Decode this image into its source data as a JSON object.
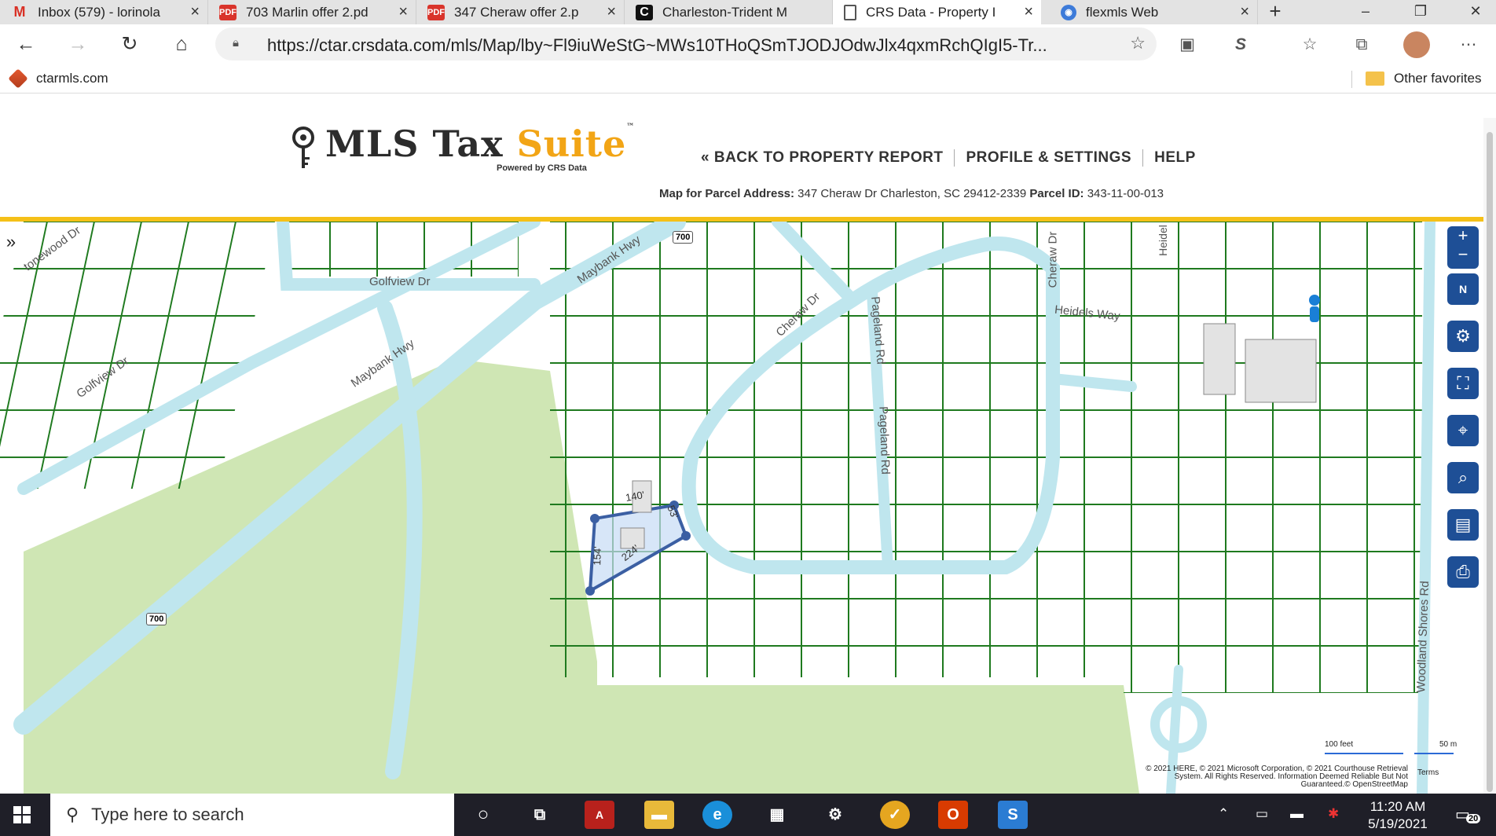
{
  "browser": {
    "tabs": [
      {
        "label": "Inbox (579) - lorinola",
        "icon": "gmail-icon"
      },
      {
        "label": "703 Marlin offer 2.pd",
        "icon": "pdf-icon"
      },
      {
        "label": "347 Cheraw offer 2.p",
        "icon": "pdf-icon"
      },
      {
        "label": "Charleston-Trident M",
        "icon": "c-icon"
      },
      {
        "label": "CRS Data - Property I",
        "icon": "page-icon"
      },
      {
        "label": "flexmls Web",
        "icon": "flexmls-icon"
      }
    ],
    "url": "https://ctar.crsdata.com/mls/Map/lby~Fl9iuWeStG~MWs10THoQSmTJODJOdwJlx4qxmRchQIgI5-Tr...",
    "favorites": {
      "site": "ctarmls.com",
      "other": "Other favorites"
    }
  },
  "header": {
    "logo_main": "MLS Tax ",
    "logo_accent": "Suite",
    "logo_tm": "™",
    "powered_by": "Powered by CRS Data",
    "nav": [
      "« BACK TO PROPERTY REPORT",
      "PROFILE & SETTINGS",
      "HELP"
    ],
    "map_for_label": "Map for Parcel Address:",
    "parcel_address": "347 Cheraw Dr Charleston, SC 29412-2339",
    "parcel_id_label": "Parcel ID:",
    "parcel_id": "343-11-00-013"
  },
  "map": {
    "side_toggle": "»",
    "street_labels": {
      "golfview_top": "Golfview Dr",
      "golfview_bottom": "Golfview Dr",
      "maybank_top": "Maybank Hwy",
      "maybank_bottom": "Maybank Hwy",
      "stonewood": "tonewood Dr",
      "cheraw_ne": "Cheraw Dr",
      "cheraw_curve": "Cheraw Dr",
      "pageland_top": "Pageland Rd",
      "pageland_bottom": "Pageland Rd",
      "heidels_way": "Heidels Way",
      "heidels_top": "Heidel",
      "woodland_shores": "Woodland Shores Rd"
    },
    "route_shields": [
      "700",
      "700"
    ],
    "parcel_dims": [
      "140'",
      "53'",
      "224'",
      "154'"
    ],
    "controls": [
      "zoom-in",
      "compass",
      "settings",
      "select-area",
      "locate",
      "search",
      "measure",
      "print"
    ],
    "scale": {
      "left": "100 feet",
      "right": "50 m"
    },
    "copyright": "© 2021 HERE, © 2021 Microsoft Corporation, © 2021 Courthouse Retrieval System. All Rights Reserved. Information Deemed Reliable But Not Guaranteed.© OpenStreetMap",
    "terms": "Terms",
    "colors": {
      "parcel_line": "#1f7a1f",
      "road": "#bfe6ee",
      "park": "#cfe6b4",
      "subject": "#3b5fa3"
    }
  },
  "taskbar": {
    "search_placeholder": "Type here to search",
    "time": "11:20 AM",
    "date": "5/19/2021",
    "notification_count": "20"
  }
}
